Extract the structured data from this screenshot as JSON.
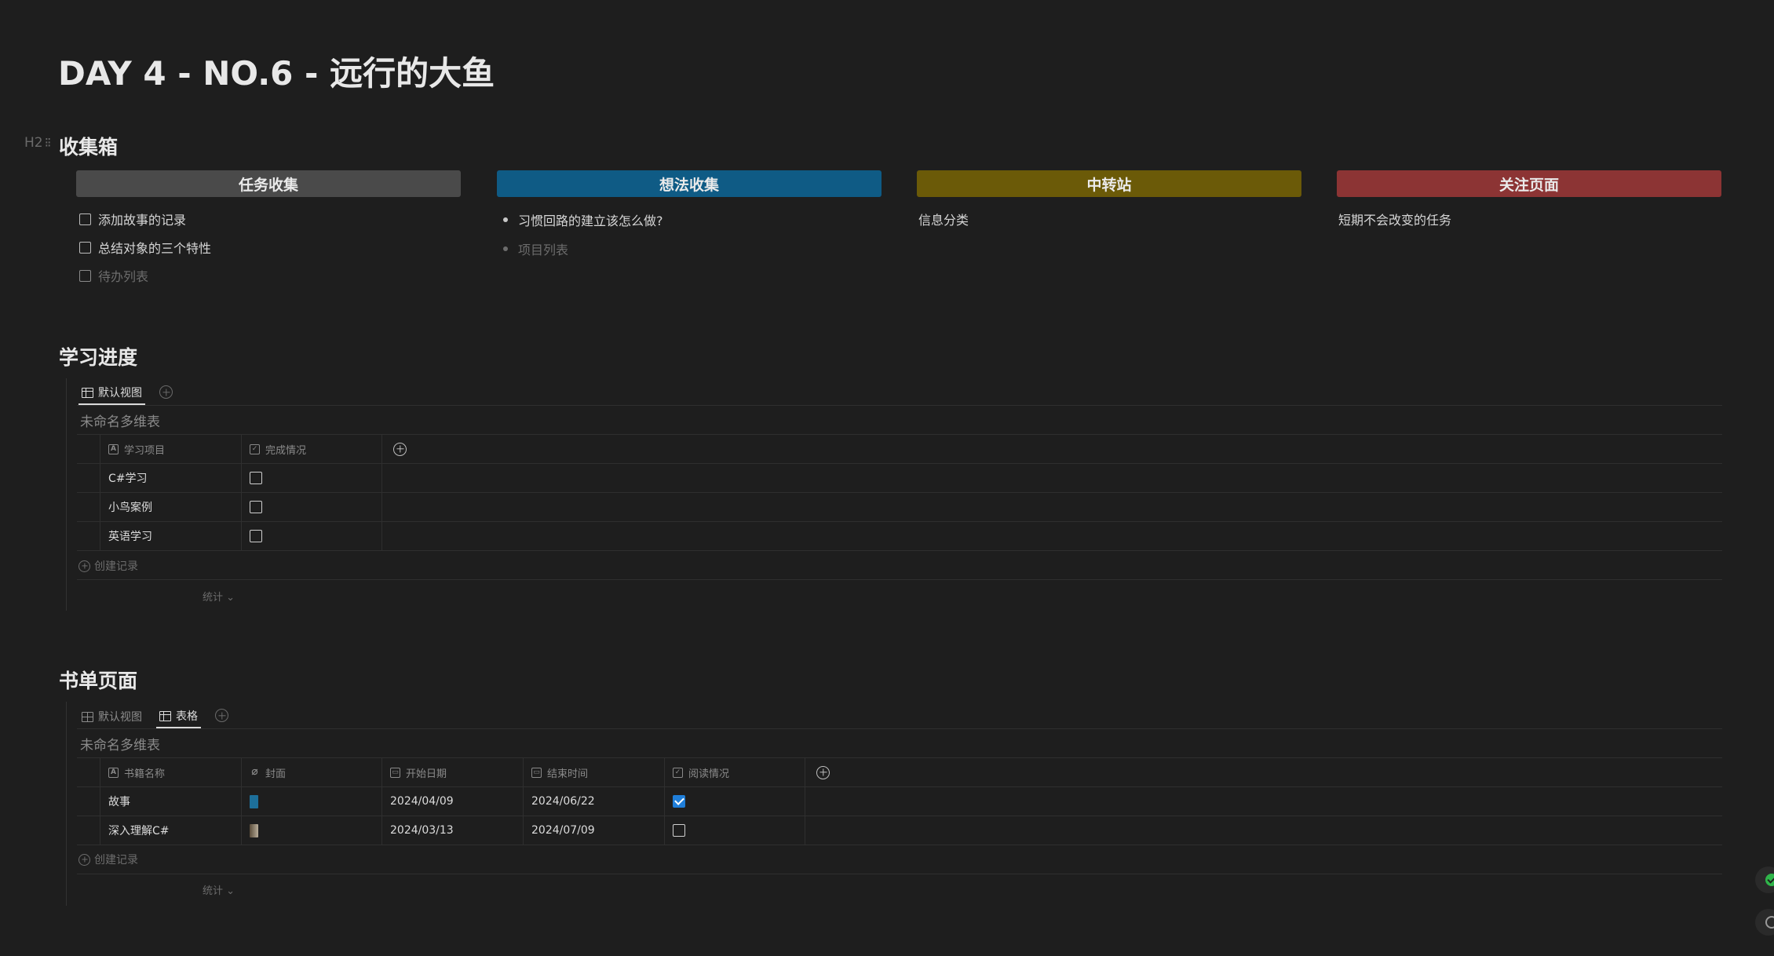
{
  "page": {
    "title": "DAY 4 - NO.6 - 远行的大鱼"
  },
  "inbox": {
    "heading": "收集箱",
    "marker": "H2",
    "columns": [
      {
        "title": "任务收集",
        "color": "#4a4a4a",
        "todos": [
          {
            "text": "添加故事的记录",
            "checked": false
          },
          {
            "text": "总结对象的三个特性",
            "checked": false
          }
        ],
        "placeholder": "待办列表"
      },
      {
        "title": "想法收集",
        "color": "#0f5b85",
        "bullets": [
          "习惯回路的建立该怎么做?"
        ],
        "placeholder": "项目列表"
      },
      {
        "title": "中转站",
        "color": "#6b5a08",
        "text": "信息分类"
      },
      {
        "title": "关注页面",
        "color": "#8c3434",
        "text": "短期不会改变的任务"
      }
    ]
  },
  "study": {
    "heading": "学习进度",
    "tabs": [
      {
        "label": "默认视图",
        "active": true
      }
    ],
    "table_name": "未命名多维表",
    "columns": [
      "学习项目",
      "完成情况"
    ],
    "rows": [
      {
        "name": "C#学习",
        "done": false
      },
      {
        "name": "小鸟案例",
        "done": false
      },
      {
        "name": "英语学习",
        "done": false
      }
    ],
    "create_label": "创建记录",
    "stats_label": "统计 ⌄"
  },
  "books": {
    "heading": "书单页面",
    "tabs": [
      {
        "label": "默认视图",
        "active": false
      },
      {
        "label": "表格",
        "active": true
      }
    ],
    "table_name": "未命名多维表",
    "columns": [
      "书籍名称",
      "封面",
      "开始日期",
      "结束时间",
      "阅读情况"
    ],
    "rows": [
      {
        "name": "故事",
        "cover_color": "#1d6f9a",
        "start": "2024/04/09",
        "end": "2024/06/22",
        "read": true
      },
      {
        "name": "深入理解C#",
        "cover_color": "#8a7d6a",
        "start": "2024/03/13",
        "end": "2024/07/09",
        "read": false
      }
    ],
    "create_label": "创建记录",
    "stats_label": "统计 ⌄"
  }
}
